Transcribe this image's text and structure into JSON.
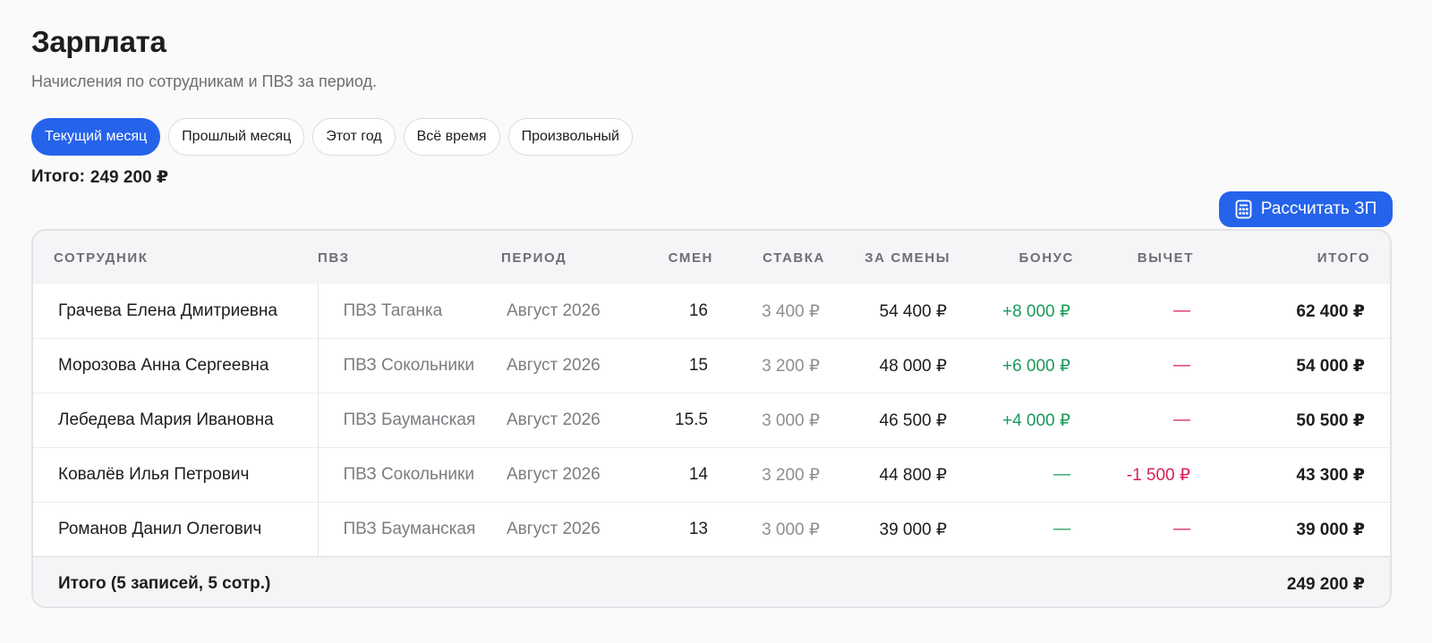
{
  "page": {
    "title": "Зарплата",
    "subtitle": "Начисления по сотрудникам и ПВЗ за период."
  },
  "filters": [
    {
      "label": "Текущий месяц",
      "active": true
    },
    {
      "label": "Прошлый месяц",
      "active": false
    },
    {
      "label": "Этот год",
      "active": false
    },
    {
      "label": "Всё время",
      "active": false
    },
    {
      "label": "Произвольный",
      "active": false
    }
  ],
  "summary": {
    "label": "Итого:",
    "value": "249 200 ₽"
  },
  "actions": {
    "calculate_label": "Рассчитать ЗП",
    "calculate_icon": "calculator-icon"
  },
  "table": {
    "columns": [
      "СОТРУДНИК",
      "ПВЗ",
      "ПЕРИОД",
      "СМЕН",
      "СТАВКА",
      "ЗА СМЕНЫ",
      "БОНУС",
      "ВЫЧЕТ",
      "ИТОГО"
    ],
    "rows": [
      {
        "employee": "Грачева Елена Дмитриевна",
        "pvz": "ПВЗ Таганка",
        "period": "Август 2026",
        "shifts": "16",
        "rate": "3 400 ₽",
        "shift_sum": "54 400 ₽",
        "bonus": "+8 000 ₽",
        "deduction": "—",
        "total": "62 400 ₽"
      },
      {
        "employee": "Морозова Анна Сергеевна",
        "pvz": "ПВЗ Сокольники",
        "period": "Август 2026",
        "shifts": "15",
        "rate": "3 200 ₽",
        "shift_sum": "48 000 ₽",
        "bonus": "+6 000 ₽",
        "deduction": "—",
        "total": "54 000 ₽"
      },
      {
        "employee": "Лебедева Мария Ивановна",
        "pvz": "ПВЗ Бауманская",
        "period": "Август 2026",
        "shifts": "15.5",
        "rate": "3 000 ₽",
        "shift_sum": "46 500 ₽",
        "bonus": "+4 000 ₽",
        "deduction": "—",
        "total": "50 500 ₽"
      },
      {
        "employee": "Ковалёв Илья Петрович",
        "pvz": "ПВЗ Сокольники",
        "period": "Август 2026",
        "shifts": "14",
        "rate": "3 200 ₽",
        "shift_sum": "44 800 ₽",
        "bonus": "—",
        "deduction": "-1 500 ₽",
        "total": "43 300 ₽"
      },
      {
        "employee": "Романов Данил Олегович",
        "pvz": "ПВЗ Бауманская",
        "period": "Август 2026",
        "shifts": "13",
        "rate": "3 000 ₽",
        "shift_sum": "39 000 ₽",
        "bonus": "—",
        "deduction": "—",
        "total": "39 000 ₽"
      }
    ],
    "footer": {
      "label": "Итого (5 записей, 5 сотр.)",
      "total": "249 200 ₽"
    }
  },
  "colors": {
    "accent": "#2563eb",
    "positive": "#1a9a5a",
    "negative": "#d61f57"
  }
}
